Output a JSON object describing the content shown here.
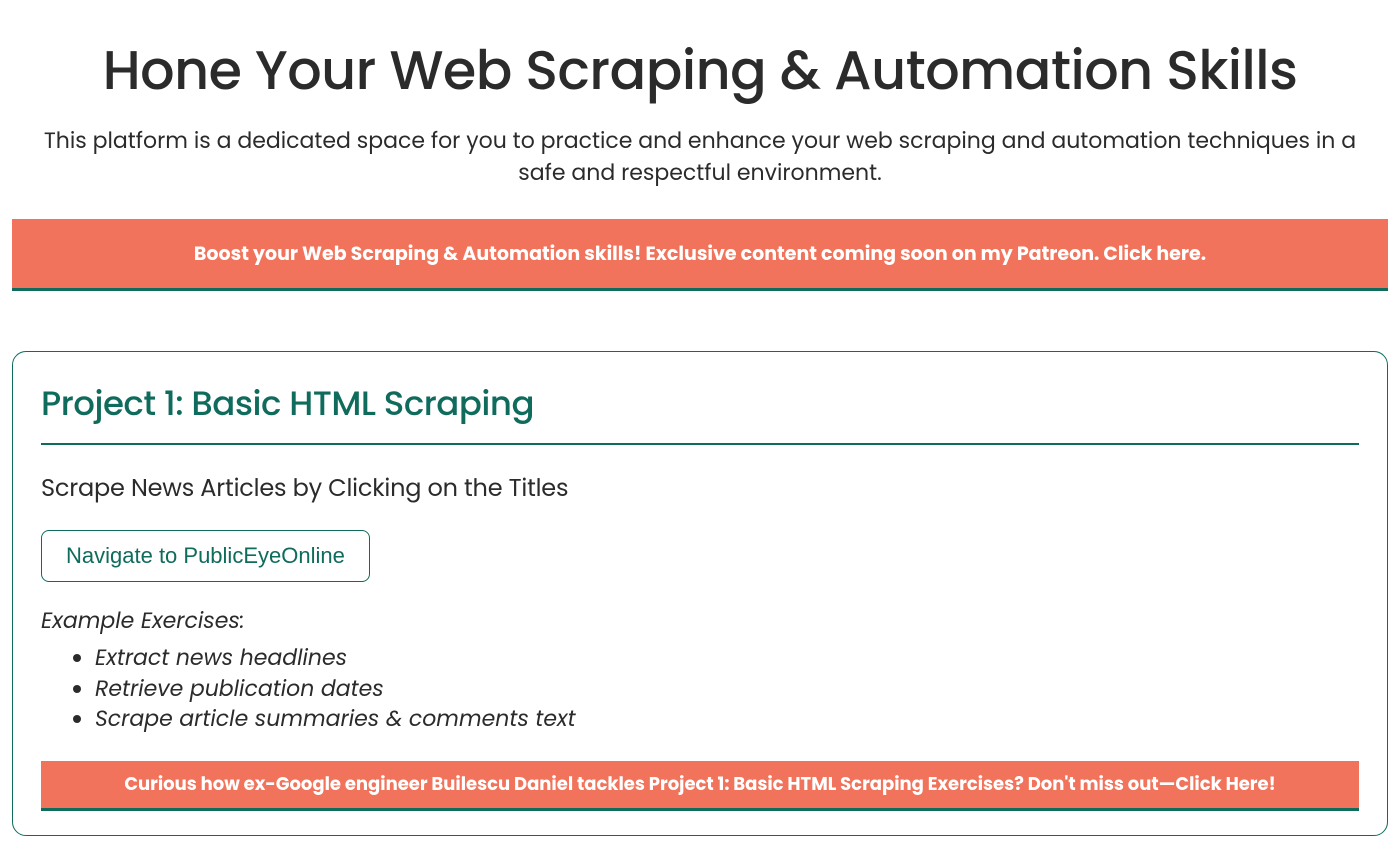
{
  "header": {
    "title": "Hone Your Web Scraping & Automation Skills",
    "subtitle": "This platform is a dedicated space for you to practice and enhance your web scraping and automation techniques in a safe and respectful environment."
  },
  "promo_banner": {
    "text": "Boost your Web Scraping & Automation skills! Exclusive content coming soon on my Patreon. Click here."
  },
  "project": {
    "title": "Project 1: Basic HTML Scraping",
    "subtitle": "Scrape News Articles by Clicking on the Titles",
    "nav_button_label": "Navigate to PublicEyeOnline",
    "exercises_label": "Example Exercises:",
    "exercises": [
      "Extract news headlines",
      "Retrieve publication dates",
      "Scrape article summaries & comments text"
    ],
    "promo_text": "Curious how ex-Google engineer Builescu Daniel tackles Project 1: Basic HTML Scraping Exercises? Don't miss out—Click Here!"
  },
  "colors": {
    "accent_teal": "#0f6b5c",
    "promo_coral": "#f2735b",
    "text_dark": "#2b2b2b"
  }
}
